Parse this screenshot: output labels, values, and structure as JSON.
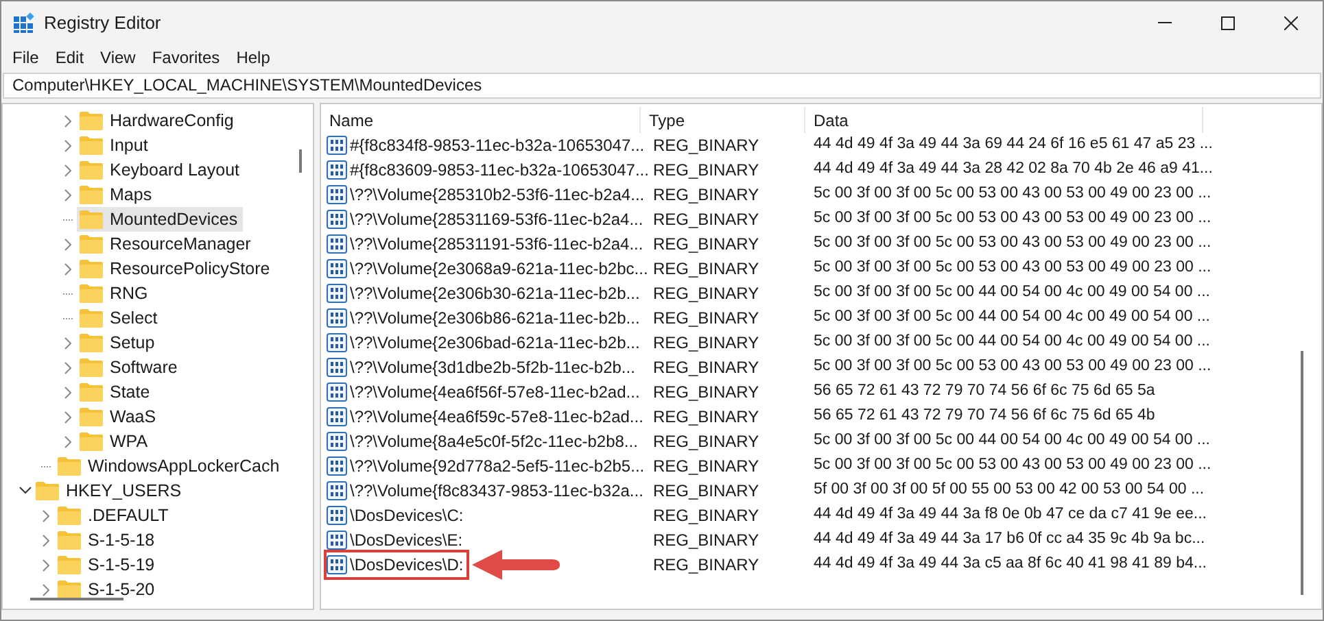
{
  "window": {
    "title": "Registry Editor"
  },
  "menu": [
    "File",
    "Edit",
    "View",
    "Favorites",
    "Help"
  ],
  "address": "Computer\\HKEY_LOCAL_MACHINE\\SYSTEM\\MountedDevices",
  "tree": [
    {
      "children": [
        {
          "children": [
            {
              "label": "HardwareConfig",
              "expanded": false,
              "selected": false
            },
            {
              "label": "Input",
              "expanded": false,
              "selected": false
            },
            {
              "label": "Keyboard Layout",
              "expanded": false,
              "selected": false
            },
            {
              "label": "Maps",
              "expanded": false,
              "selected": false
            },
            {
              "label": "MountedDevices",
              "selected": true
            },
            {
              "label": "ResourceManager",
              "expanded": false,
              "selected": false
            },
            {
              "label": "ResourcePolicyStore",
              "expanded": false,
              "selected": false
            },
            {
              "label": "RNG",
              "selected": false
            },
            {
              "label": "Select",
              "selected": false
            },
            {
              "label": "Setup",
              "expanded": false,
              "selected": false
            },
            {
              "label": "Software",
              "expanded": false,
              "selected": false
            },
            {
              "label": "State",
              "expanded": false,
              "selected": false
            },
            {
              "label": "WaaS",
              "expanded": false,
              "selected": false
            },
            {
              "label": "WPA",
              "expanded": false,
              "selected": false
            }
          ]
        },
        {
          "label": "WindowsAppLockerCach",
          "selected": false
        }
      ]
    },
    {
      "label": "HKEY_USERS",
      "expanded": true,
      "selected": false,
      "children": [
        {
          "label": ".DEFAULT",
          "expanded": false,
          "selected": false
        },
        {
          "label": "S-1-5-18",
          "expanded": false,
          "selected": false
        },
        {
          "label": "S-1-5-19",
          "expanded": false,
          "selected": false
        },
        {
          "label": "S-1-5-20",
          "expanded": false,
          "selected": false
        }
      ]
    }
  ],
  "values": {
    "columns": [
      "Name",
      "Type",
      "Data"
    ],
    "rows": [
      {
        "name": "#{f8c834f8-9853-11ec-b32a-10653047...",
        "type": "REG_BINARY",
        "data": "44 4d 49 4f 3a 49 44 3a 69 44 24 6f 16 e5 61 47 a5 23 ...",
        "callout": false
      },
      {
        "name": "#{f8c83609-9853-11ec-b32a-10653047...",
        "type": "REG_BINARY",
        "data": "44 4d 49 4f 3a 49 44 3a 28 42 02 8a 70 4b 2e 46 a9 41...",
        "callout": false
      },
      {
        "name": "\\??\\Volume{285310b2-53f6-11ec-b2a4...",
        "type": "REG_BINARY",
        "data": "5c 00 3f 00 3f 00 5c 00 53 00 43 00 53 00 49 00 23 00 ...",
        "callout": false
      },
      {
        "name": "\\??\\Volume{28531169-53f6-11ec-b2a4...",
        "type": "REG_BINARY",
        "data": "5c 00 3f 00 3f 00 5c 00 53 00 43 00 53 00 49 00 23 00 ...",
        "callout": false
      },
      {
        "name": "\\??\\Volume{28531191-53f6-11ec-b2a4...",
        "type": "REG_BINARY",
        "data": "5c 00 3f 00 3f 00 5c 00 53 00 43 00 53 00 49 00 23 00 ...",
        "callout": false
      },
      {
        "name": "\\??\\Volume{2e3068a9-621a-11ec-b2bc...",
        "type": "REG_BINARY",
        "data": "5c 00 3f 00 3f 00 5c 00 53 00 43 00 53 00 49 00 23 00 ...",
        "callout": false
      },
      {
        "name": "\\??\\Volume{2e306b30-621a-11ec-b2b...",
        "type": "REG_BINARY",
        "data": "5c 00 3f 00 3f 00 5c 00 44 00 54 00 4c 00 49 00 54 00 ...",
        "callout": false
      },
      {
        "name": "\\??\\Volume{2e306b86-621a-11ec-b2b...",
        "type": "REG_BINARY",
        "data": "5c 00 3f 00 3f 00 5c 00 44 00 54 00 4c 00 49 00 54 00 ...",
        "callout": false
      },
      {
        "name": "\\??\\Volume{2e306bad-621a-11ec-b2b...",
        "type": "REG_BINARY",
        "data": "5c 00 3f 00 3f 00 5c 00 44 00 54 00 4c 00 49 00 54 00 ...",
        "callout": false
      },
      {
        "name": "\\??\\Volume{3d1dbe2b-5f2b-11ec-b2b...",
        "type": "REG_BINARY",
        "data": "5c 00 3f 00 3f 00 5c 00 53 00 43 00 53 00 49 00 23 00 ...",
        "callout": false
      },
      {
        "name": "\\??\\Volume{4ea6f56f-57e8-11ec-b2ad...",
        "type": "REG_BINARY",
        "data": "56 65 72 61 43 72 79 70 74 56 6f 6c 75 6d 65 5a",
        "callout": false
      },
      {
        "name": "\\??\\Volume{4ea6f59c-57e8-11ec-b2ad...",
        "type": "REG_BINARY",
        "data": "56 65 72 61 43 72 79 70 74 56 6f 6c 75 6d 65 4b",
        "callout": false
      },
      {
        "name": "\\??\\Volume{8a4e5c0f-5f2c-11ec-b2b8...",
        "type": "REG_BINARY",
        "data": "5c 00 3f 00 3f 00 5c 00 44 00 54 00 4c 00 49 00 54 00 ...",
        "callout": false
      },
      {
        "name": "\\??\\Volume{92d778a2-5ef5-11ec-b2b5...",
        "type": "REG_BINARY",
        "data": "5c 00 3f 00 3f 00 5c 00 53 00 43 00 53 00 49 00 23 00 ...",
        "callout": false
      },
      {
        "name": "\\??\\Volume{f8c83437-9853-11ec-b32a...",
        "type": "REG_BINARY",
        "data": "5f 00 3f 00 3f 00 5f 00 55 00 53 00 42 00 53 00 54 00 ...",
        "callout": false
      },
      {
        "name": "\\DosDevices\\C:",
        "type": "REG_BINARY",
        "data": "44 4d 49 4f 3a 49 44 3a f8 0e 0b 47 ce da c7 41 9e ee...",
        "callout": false
      },
      {
        "name": "\\DosDevices\\E:",
        "type": "REG_BINARY",
        "data": "44 4d 49 4f 3a 49 44 3a 17 b6 0f cc a4 35 9c 4b 9a bc...",
        "callout": false
      },
      {
        "name": "\\DosDevices\\D:",
        "type": "REG_BINARY",
        "data": "44 4d 49 4f 3a 49 44 3a c5 aa 8f 6c 40 41 98 41 89 b4...",
        "callout": true
      }
    ]
  }
}
